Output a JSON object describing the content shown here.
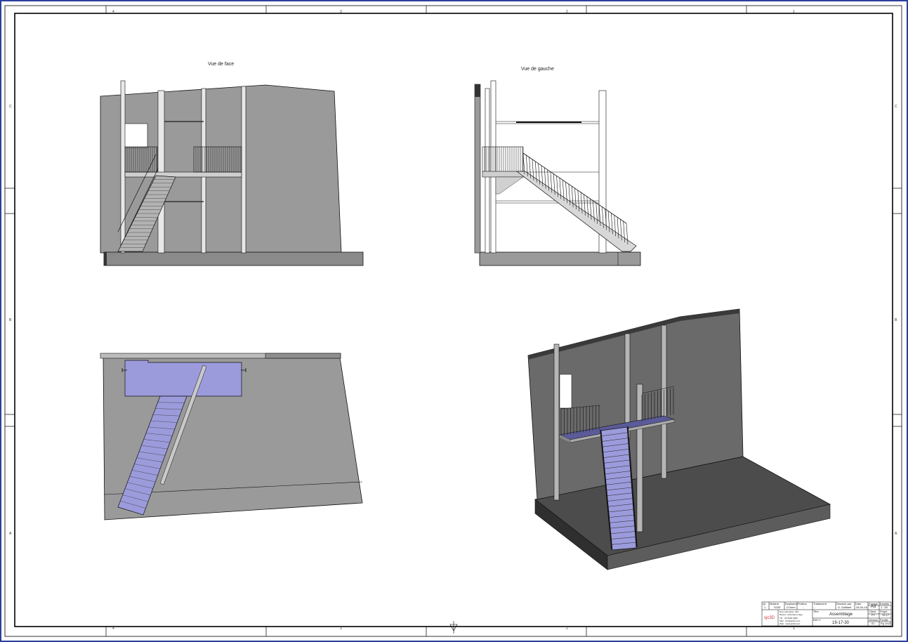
{
  "views": {
    "front": {
      "title": "Vue de face"
    },
    "left": {
      "title": "Vue de gauche"
    },
    "top": {
      "title": ""
    },
    "iso": {
      "title": ""
    }
  },
  "frame": {
    "columns_top": [
      "4",
      "3",
      "2",
      "1"
    ],
    "columns_bottom": [
      "4",
      "3",
      "2",
      "1"
    ],
    "rows_left": [
      "C",
      "B",
      "A"
    ],
    "rows_right": [
      "C",
      "B",
      "A"
    ]
  },
  "title_block": {
    "company_logo": "sjc3D",
    "address_lines": [
      "Rue Lafontaine, 184",
      "Boulev. Lafontaine Liège",
      "Tél. : 00 0000 0000",
      "Mail : info@sjc3d.com",
      "Web : www.sjc3d.com"
    ],
    "fields": {
      "qty_label": "Qt",
      "qty": "1",
      "material_label": "Matière",
      "material": "S235",
      "thickness_label": "Epaisseur",
      "thickness": "-0.0mm",
      "finish_label": "Finition",
      "finish": "-",
      "treatment_label": "Traitement",
      "treatment": "-",
      "drawn_by_label": "Dessiné par",
      "drawn_by": "U. Gaffaert",
      "date_label": "Date",
      "date": "28-04-16",
      "format_label": "Format",
      "format": "A3",
      "scale_label": "Echelle",
      "scale": "1 : 50",
      "title_label": "Titre",
      "title": "Assemblage",
      "client_label": "Client",
      "client": "PJ",
      "project_label": "Projet",
      "project": "19-17",
      "ref_label": "Réf n°",
      "ref": "19-17-30",
      "version_label": "Version",
      "version": "01",
      "page_label": "Feuille",
      "page": "Pg 1/n/1"
    }
  },
  "colors": {
    "wall": "#9a9a9a",
    "wall_dark": "#6a6a6a",
    "floor": "#8a8a8a",
    "floor_dark": "#4a4a4a",
    "selection": "#9b9bdc",
    "line": "#111111"
  }
}
